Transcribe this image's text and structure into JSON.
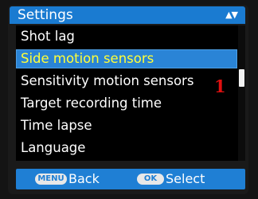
{
  "header": {
    "title": "Settings",
    "arrows": "▲▼"
  },
  "menu": {
    "items": [
      {
        "label": "Shot lag",
        "selected": false
      },
      {
        "label": "Side motion sensors",
        "selected": true
      },
      {
        "label": "Sensitivity motion sensors",
        "selected": false
      },
      {
        "label": "Target recording time",
        "selected": false
      },
      {
        "label": "Time lapse",
        "selected": false
      },
      {
        "label": "Language",
        "selected": false
      }
    ]
  },
  "annotation": "1",
  "footer": {
    "menu_key": "MENU",
    "back_label": "Back",
    "ok_key": "OK",
    "select_label": "Select"
  },
  "colors": {
    "header_bg": "#1a7bd1",
    "selected_bg": "#2a84d6",
    "selected_text": "#ffff38",
    "annotation": "#e01010"
  }
}
